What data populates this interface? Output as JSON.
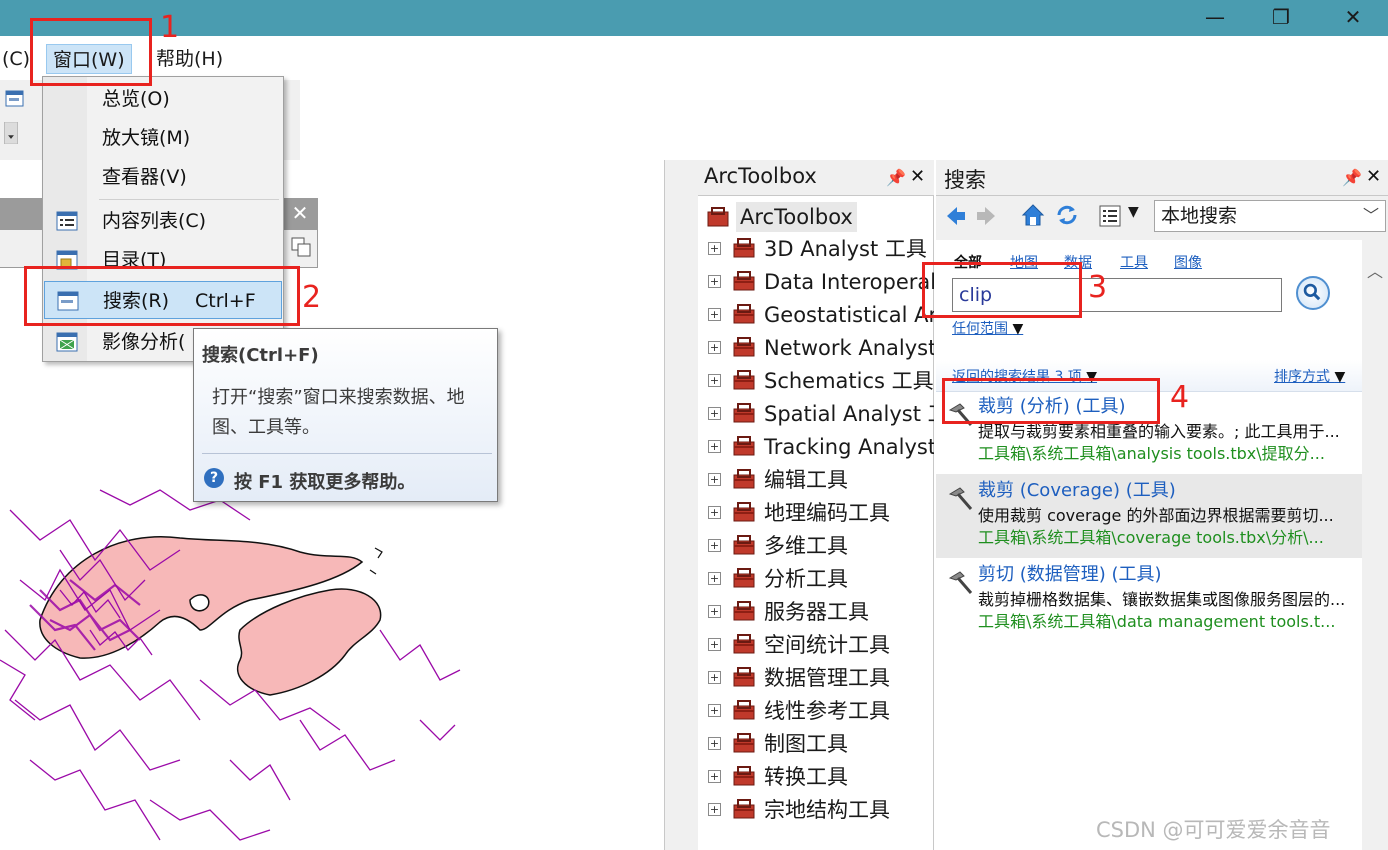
{
  "window": {
    "controls": {
      "minimize": "—",
      "maximize": "❐",
      "close": "✕"
    }
  },
  "menubar": {
    "items": [
      "(C)",
      "窗口(W)",
      "帮助(H)"
    ]
  },
  "window_menu": {
    "items": [
      {
        "label": "总览(O)",
        "icon": ""
      },
      {
        "label": "放大镜(M)",
        "icon": ""
      },
      {
        "label": "查看器(V)",
        "icon": ""
      },
      {
        "label": "内容列表(C)",
        "icon": "table-of-contents-icon"
      },
      {
        "label": "目录(T)",
        "icon": "catalog-icon"
      },
      {
        "label": "搜索(R)",
        "shortcut": "Ctrl+F",
        "icon": "search-window-icon"
      },
      {
        "label": "影像分析(",
        "icon": "image-analysis-icon"
      }
    ]
  },
  "tooltip": {
    "title": "搜索(Ctrl+F)",
    "description": "打开“搜索”窗口来搜索数据、地图、工具等。",
    "help": "按 F1 获取更多帮助。"
  },
  "annotations": {
    "numbers": [
      "1",
      "2",
      "3",
      "4"
    ],
    "color": "#e8231f"
  },
  "arctoolbox": {
    "title": "ArcToolbox",
    "root": "ArcToolbox",
    "toolboxes": [
      "3D Analyst 工具",
      "Data Interoperability",
      "Geostatistical Analyst",
      "Network Analyst",
      "Schematics 工具",
      "Spatial Analyst 工具",
      "Tracking Analyst",
      "编辑工具",
      "地理编码工具",
      "多维工具",
      "分析工具",
      "服务器工具",
      "空间统计工具",
      "数据管理工具",
      "线性参考工具",
      "制图工具",
      "转换工具",
      "宗地结构工具"
    ]
  },
  "search_panel": {
    "title": "搜索",
    "scope_select": "本地搜索",
    "tabs": [
      "全部",
      "地图",
      "数据",
      "工具",
      "图像"
    ],
    "query": "clip",
    "scope_link": "任何范围",
    "result_count": "返回的搜索结果 3 项",
    "sort_label": "排序方式",
    "results": [
      {
        "title": "裁剪 (分析) (工具)",
        "description": "提取与裁剪要素相重叠的输入要素。; 此工具用于...",
        "path": "工具箱\\系统工具箱\\analysis tools.tbx\\提取分..."
      },
      {
        "title": "裁剪 (Coverage) (工具)",
        "description": "使用裁剪 coverage 的外部面边界根据需要剪切...",
        "path": "工具箱\\系统工具箱\\coverage tools.tbx\\分析\\..."
      },
      {
        "title": "剪切 (数据管理) (工具)",
        "description": "裁剪掉栅格数据集、镶嵌数据集或图像服务图层的...",
        "path": "工具箱\\系统工具箱\\data management tools.t..."
      }
    ]
  },
  "colors": {
    "titlebar": "#4a9cb0",
    "link": "#1e5fbf",
    "path_green": "#1f8f1f",
    "map_lines": "#9b0aa8",
    "map_fill": "#f7b8b8"
  },
  "watermark": "CSDN @可可爱爱余音音"
}
